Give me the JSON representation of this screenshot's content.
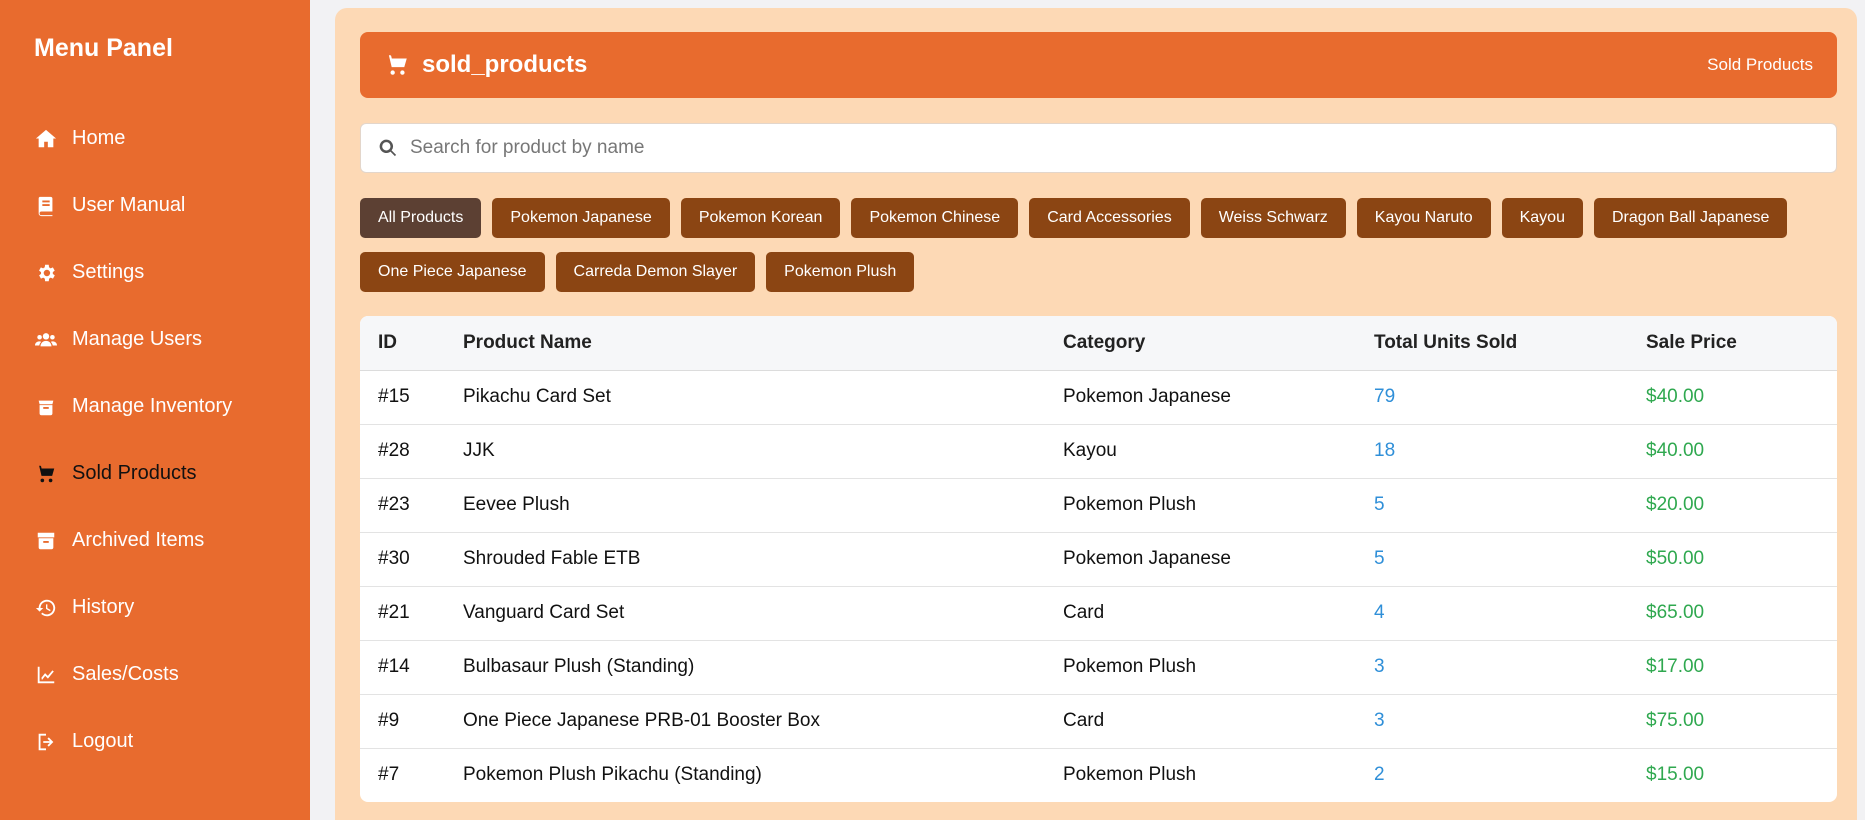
{
  "sidebar": {
    "title": "Menu Panel",
    "items": [
      {
        "label": "Home",
        "icon": "home-icon"
      },
      {
        "label": "User Manual",
        "icon": "book-icon"
      },
      {
        "label": "Settings",
        "icon": "gear-icon"
      },
      {
        "label": "Manage Users",
        "icon": "users-icon"
      },
      {
        "label": "Manage Inventory",
        "icon": "box-icon"
      },
      {
        "label": "Sold Products",
        "icon": "cart-icon",
        "active": true
      },
      {
        "label": "Archived Items",
        "icon": "archive-icon"
      },
      {
        "label": "History",
        "icon": "history-icon"
      },
      {
        "label": "Sales/Costs",
        "icon": "chart-line-icon"
      },
      {
        "label": "Logout",
        "icon": "logout-icon"
      }
    ]
  },
  "header": {
    "title": "sold_products",
    "breadcrumb": "Sold Products",
    "icon": "cart-icon"
  },
  "search": {
    "placeholder": "Search for product by name",
    "value": ""
  },
  "filters": [
    "All Products",
    "Pokemon Japanese",
    "Pokemon Korean",
    "Pokemon Chinese",
    "Card Accessories",
    "Weiss Schwarz",
    "Kayou Naruto",
    "Kayou",
    "Dragon Ball Japanese",
    "One Piece Japanese",
    "Carreda Demon Slayer",
    "Pokemon Plush"
  ],
  "active_filter": "All Products",
  "table": {
    "columns": [
      "ID",
      "Product Name",
      "Category",
      "Total Units Sold",
      "Sale Price"
    ],
    "rows": [
      [
        "#15",
        "Pikachu Card Set",
        "Pokemon Japanese",
        "79",
        "$40.00"
      ],
      [
        "#28",
        "JJK",
        "Kayou",
        "18",
        "$40.00"
      ],
      [
        "#23",
        "Eevee Plush",
        "Pokemon Plush",
        "5",
        "$20.00"
      ],
      [
        "#30",
        "Shrouded Fable ETB",
        "Pokemon Japanese",
        "5",
        "$50.00"
      ],
      [
        "#21",
        "Vanguard Card Set",
        "Card",
        "4",
        "$65.00"
      ],
      [
        "#14",
        "Bulbasaur Plush (Standing)",
        "Pokemon Plush",
        "3",
        "$17.00"
      ],
      [
        "#9",
        "One Piece Japanese PRB-01 Booster Box",
        "Card",
        "3",
        "$75.00"
      ],
      [
        "#7",
        "Pokemon Plush Pikachu (Standing)",
        "Pokemon Plush",
        "2",
        "$15.00"
      ]
    ]
  },
  "colors": {
    "sidebar": "#e86b2e",
    "main_bg": "#fdd9b5",
    "chip": "#8b4513",
    "chip_active": "#5c4033",
    "units": "#2f8fd8",
    "price": "#2fa84f"
  }
}
